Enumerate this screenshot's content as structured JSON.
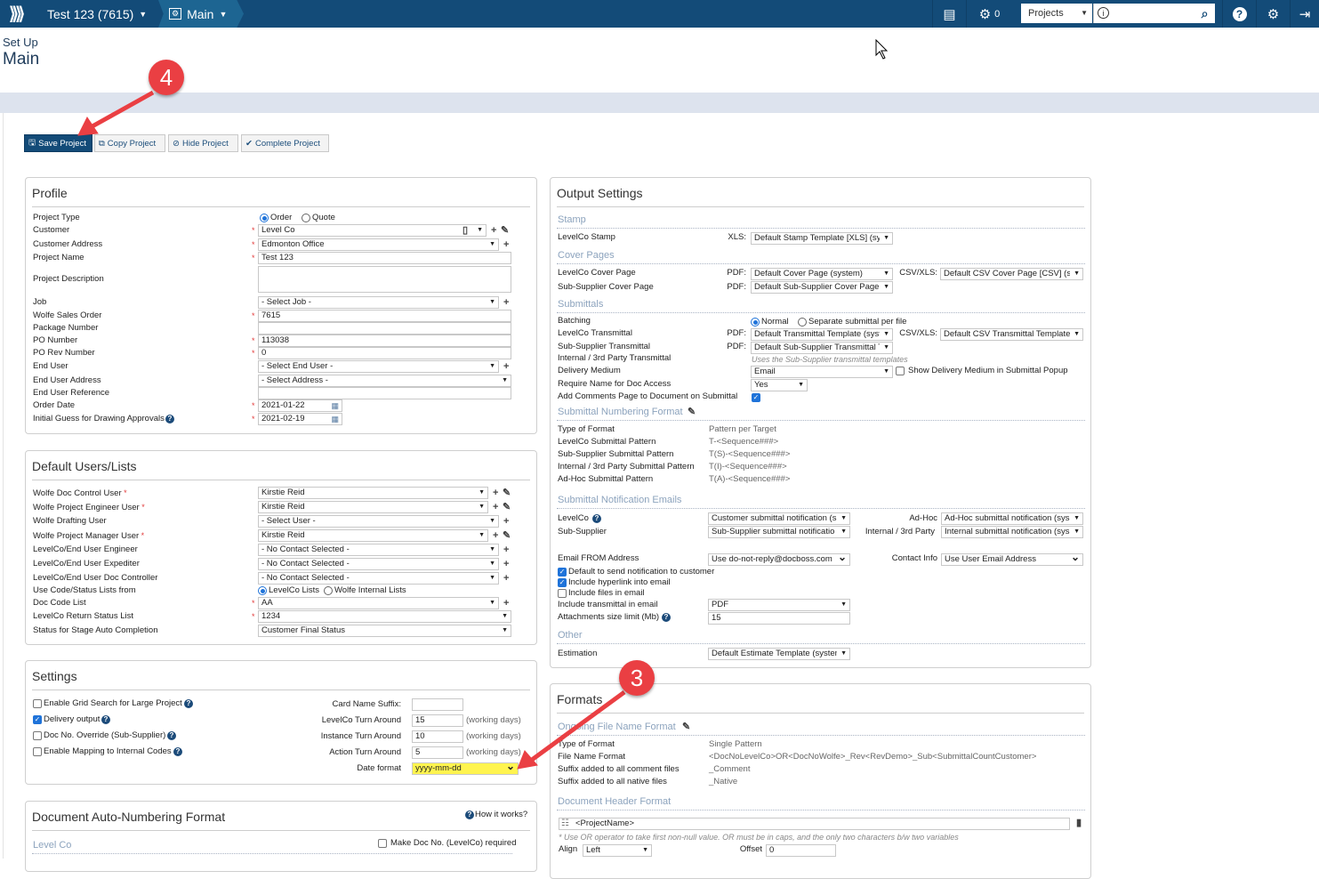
{
  "topbar": {
    "project": "Test 123 (7615)",
    "module": "Main",
    "notification_count": "0",
    "search_scope": "Projects",
    "search_value": ""
  },
  "page": {
    "breadcrumb": "Set Up",
    "title": "Main"
  },
  "toolbar": {
    "save": "Save Project",
    "copy": "Copy Project",
    "hide": "Hide Project",
    "complete": "Complete Project"
  },
  "annotations": {
    "step4": "4",
    "step3": "3",
    "color": "#ea3f43"
  },
  "colors": {
    "brand": "#134b78",
    "highlight": "#fff44f",
    "heading": "#8ca3bd"
  },
  "profile": {
    "title": "Profile",
    "project_type": {
      "label": "Project Type",
      "options": [
        "Order",
        "Quote"
      ],
      "selected": "Order"
    },
    "customer": {
      "label": "Customer",
      "value": "Level Co",
      "required": true
    },
    "customer_address": {
      "label": "Customer Address",
      "value": "Edmonton Office",
      "required": true
    },
    "project_name": {
      "label": "Project Name",
      "value": "Test 123",
      "required": true
    },
    "project_description": {
      "label": "Project Description",
      "value": ""
    },
    "job": {
      "label": "Job",
      "value": "- Select Job -"
    },
    "wolfe_sales_order": {
      "label": "Wolfe Sales Order",
      "value": "7615",
      "required": true
    },
    "package_number": {
      "label": "Package Number",
      "value": ""
    },
    "po_number": {
      "label": "PO Number",
      "value": "113038",
      "required": true
    },
    "po_rev_number": {
      "label": "PO Rev Number",
      "value": "0",
      "required": true
    },
    "end_user": {
      "label": "End User",
      "value": "- Select End User -"
    },
    "end_user_address": {
      "label": "End User Address",
      "value": "- Select Address -"
    },
    "end_user_reference": {
      "label": "End User Reference",
      "value": ""
    },
    "order_date": {
      "label": "Order Date",
      "value": "2021-01-22",
      "required": true
    },
    "initial_guess": {
      "label": "Initial Guess for Drawing Approvals",
      "value": "2021-02-19",
      "required": true
    }
  },
  "default_users": {
    "title": "Default Users/Lists",
    "doc_control_user": {
      "label": "Wolfe Doc Control User",
      "value": "Kirstie Reid",
      "required": true
    },
    "project_engineer_user": {
      "label": "Wolfe Project Engineer User",
      "value": "Kirstie Reid",
      "required": true
    },
    "drafting_user": {
      "label": "Wolfe Drafting User",
      "value": "- Select User -"
    },
    "project_manager_user": {
      "label": "Wolfe Project Manager User",
      "value": "Kirstie Reid",
      "required": true
    },
    "end_user_engineer": {
      "label": "LevelCo/End User Engineer",
      "value": "- No Contact Selected -"
    },
    "end_user_expediter": {
      "label": "LevelCo/End User Expediter",
      "value": "- No Contact Selected -"
    },
    "end_user_doc_controller": {
      "label": "LevelCo/End User Doc Controller",
      "value": "- No Contact Selected -"
    },
    "use_code_lists": {
      "label": "Use Code/Status Lists from",
      "options": [
        "LevelCo Lists",
        "Wolfe Internal Lists"
      ],
      "selected": "LevelCo Lists"
    },
    "doc_code_list": {
      "label": "Doc Code List",
      "value": "AA",
      "required": true
    },
    "return_status_list": {
      "label": "LevelCo Return Status List",
      "value": "1234",
      "required": true
    },
    "stage_auto_completion": {
      "label": "Status for Stage Auto Completion",
      "value": "Customer Final Status"
    }
  },
  "settings": {
    "title": "Settings",
    "grid_search": {
      "label": "Enable Grid Search for Large Project",
      "checked": false
    },
    "delivery_output": {
      "label": "Delivery output",
      "checked": true
    },
    "doc_no_override": {
      "label": "Doc No. Override (Sub-Supplier)",
      "checked": false
    },
    "mapping_internal": {
      "label": "Enable Mapping to Internal Codes",
      "checked": false
    },
    "card_name_suffix": {
      "label": "Card Name Suffix:",
      "value": ""
    },
    "levelco_turn_around": {
      "label": "LevelCo Turn Around",
      "value": "15",
      "unit": "(working days)"
    },
    "instance_turn_around": {
      "label": "Instance Turn Around",
      "value": "10",
      "unit": "(working days)"
    },
    "action_turn_around": {
      "label": "Action Turn Around",
      "value": "5",
      "unit": "(working days)"
    },
    "date_format": {
      "label": "Date format",
      "value": "yyyy-mm-dd"
    }
  },
  "auto_numbering": {
    "title": "Document Auto-Numbering Format",
    "how_it_works": "How it works?",
    "section": "Level Co",
    "make_required": {
      "label": "Make Doc No. (LevelCo) required",
      "checked": false
    }
  },
  "output": {
    "title": "Output Settings",
    "stamp": {
      "heading": "Stamp",
      "levelco_stamp": "LevelCo Stamp",
      "xls_label": "XLS:",
      "xls_value": "Default Stamp Template [XLS] (sys"
    },
    "cover": {
      "heading": "Cover Pages",
      "levelco": "LevelCo Cover Page",
      "pdf_label": "PDF:",
      "levelco_pdf": "Default Cover Page (system)",
      "csv_label": "CSV/XLS:",
      "levelco_csv": "Default CSV Cover Page [CSV] (sy:",
      "sub": "Sub-Supplier Cover Page",
      "sub_pdf": "Default Sub-Supplier Cover Page ("
    },
    "submittals": {
      "heading": "Submittals",
      "batching": "Batching",
      "batching_options": [
        "Normal",
        "Separate submittal per file"
      ],
      "batching_selected": "Normal",
      "levelco_transmittal": "LevelCo Transmittal",
      "levelco_pdf": "Default Transmittal Template (syst",
      "levelco_csv": "Default CSV Transmittal Template",
      "sub_transmittal": "Sub-Supplier Transmittal",
      "sub_pdf": "Default Sub-Supplier Transmittal T",
      "internal_transmittal": "Internal / 3rd Party Transmittal",
      "internal_note": "Uses the Sub-Supplier transmittal templates",
      "delivery_medium": "Delivery Medium",
      "delivery_value": "Email",
      "show_delivery": {
        "label": "Show Delivery Medium in Submittal Popup",
        "checked": false
      },
      "require_name": "Require Name for Doc Access",
      "require_value": "Yes",
      "add_comments": "Add Comments Page to Document on Submittal",
      "add_comments_check": {
        "label": "",
        "checked": true
      }
    },
    "numbering": {
      "heading": "Submittal Numbering Format",
      "type_label": "Type of Format",
      "type_value": "Pattern per Target",
      "patterns": [
        {
          "label": "LevelCo Submittal Pattern",
          "value": "T-<Sequence###>"
        },
        {
          "label": "Sub-Supplier Submittal Pattern",
          "value": "T(S)-<Sequence###>"
        },
        {
          "label": "Internal / 3rd Party Submittal Pattern",
          "value": "T(I)-<Sequence###>"
        },
        {
          "label": "Ad-Hoc Submittal Pattern",
          "value": "T(A)-<Sequence###>"
        }
      ]
    },
    "emails": {
      "heading": "Submittal Notification Emails",
      "levelco": "LevelCo",
      "levelco_value": "Customer submittal notification (s",
      "adhoc": "Ad-Hoc",
      "adhoc_value": "Ad-Hoc submittal notification (sys",
      "sub": "Sub-Supplier",
      "sub_value": "Sub-Supplier submittal notificatio",
      "internal": "Internal / 3rd Party",
      "internal_value": "Internal submittal notification (sys",
      "from_label": "Email FROM Address",
      "from_value": "Use do-not-reply@docboss.com",
      "contact_label": "Contact Info",
      "contact_value": "Use User Email Address",
      "default_send": {
        "label": "Default to send notification to customer",
        "checked": true
      },
      "hyperlink": {
        "label": "Include hyperlink into email",
        "checked": true
      },
      "files": {
        "label": "Include files in email",
        "checked": false
      },
      "transmittal_label": "Include transmittal in email",
      "transmittal_value": "PDF",
      "size_label": "Attachments size limit (Mb)",
      "size_value": "15"
    },
    "other": {
      "heading": "Other",
      "estimation": "Estimation",
      "estimation_value": "Default Estimate Template (systen"
    }
  },
  "formats": {
    "title": "Formats",
    "file_heading": "Ongoing File Name Format",
    "type_label": "Type of Format",
    "type_value": "Single Pattern",
    "file_label": "File Name Format",
    "file_value": "<DocNoLevelCo>OR<DocNoWolfe>_Rev<RevDemo>_Sub<SubmittalCountCustomer>",
    "comment_label": "Suffix added to all comment files",
    "comment_value": "_Comment",
    "native_label": "Suffix added to all native files",
    "native_value": "_Native",
    "header_heading": "Document Header Format",
    "header_value": "<ProjectName>",
    "header_note": "* Use OR operator to take first non-null value. OR must be in caps, and the only two characters b/w two variables",
    "align_label": "Align",
    "align_value": "Left",
    "offset_label": "Offset",
    "offset_value": "0"
  }
}
